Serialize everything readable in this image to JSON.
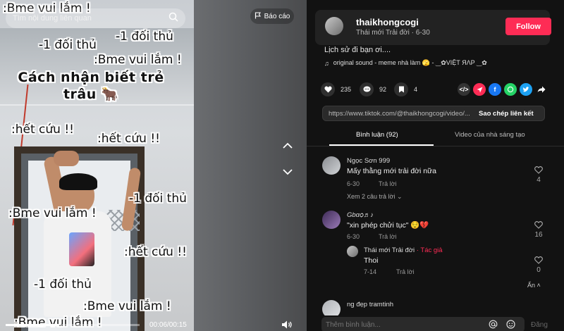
{
  "video": {
    "search_placeholder": "Tìm nội dung liên quan",
    "overlay_title": "Cách nhận biết trẻ\ntrâu 🐂",
    "overlays": [
      ":Bme vui lắm !",
      "-1 đối thủ",
      "-1 đối thủ",
      ":Bme vui lắm !",
      ":hết cứu !!",
      ":hết cứu !!",
      "-1 đối thủ",
      ":Bme vui lắm !",
      ":hết cứu !!",
      "-1 đối thủ",
      ":Bme vui lắm !",
      ":Bme vui lắm !"
    ],
    "time": "00:06/00:15",
    "progress": 0.4
  },
  "middle": {
    "report_label": "Báo cáo"
  },
  "author": {
    "name": "thaikhongcogi",
    "subtitle": "Thái mới Trải đời · 6-30",
    "follow_label": "Follow"
  },
  "description": "Lịch sử đi bạn ơi....",
  "sound": "original sound - meme nhà làm 🫣 - ‿✿VIỆT ЯΛP ‿✿",
  "actions": {
    "likes": "235",
    "comments": "92",
    "saves": "4"
  },
  "share": {
    "link": "https://www.tiktok.com/@thaikhongcogi/video/...",
    "copy_label": "Sao chép liên kết"
  },
  "tabs": {
    "comments": "Bình luận (92)",
    "creator_videos": "Video của nhà sáng tạo"
  },
  "comments": [
    {
      "name": "Ngọc Sơn 999",
      "text": "Mấy thằng mới trải đời nữa",
      "date": "6-30",
      "reply": "Trả lời",
      "likes": "4",
      "more": "Xem 2 câu trả lời"
    },
    {
      "name": "Gbαѻ♬♪",
      "text": "\"xin phép chửi tục\" 😌💔",
      "date": "6-30",
      "reply": "Trả lời",
      "likes": "16"
    },
    {
      "name": "Thái mới Trải đời",
      "author_tag": " · Tác giả",
      "text": "Thoi",
      "date": "7-14",
      "reply": "Trả lời",
      "likes": "0",
      "hide": "Ẩn"
    },
    {
      "name": "ng đẹp tramtinh"
    }
  ],
  "comment_input": {
    "placeholder": "Thêm bình luận...",
    "post_label": "Đăng"
  },
  "colors": {
    "accent": "#fe2c55",
    "panel_bg": "#121212",
    "card_bg": "#222222"
  }
}
